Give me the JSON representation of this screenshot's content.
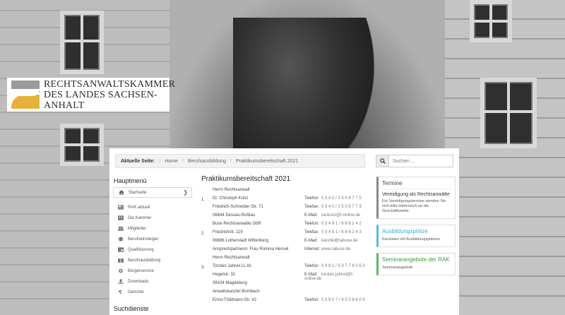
{
  "logo": {
    "line1": "RECHTSANWALTSKAMMER",
    "line2": "DES LANDES SACHSEN-ANHALT"
  },
  "breadcrumb": {
    "label": "Aktuelle Seite:",
    "items": [
      "Home",
      "Berufsausbildung",
      "Praktikumsbereitschaft 2021"
    ]
  },
  "search": {
    "placeholder": "Suchen ..."
  },
  "menu": {
    "title": "Hauptmenü",
    "items": [
      {
        "label": "Startseite",
        "icon": "home-icon"
      },
      {
        "label": "RAK aktuell",
        "icon": "news-icon"
      },
      {
        "label": "Die Kammer",
        "icon": "building-icon"
      },
      {
        "label": "Mitglieder",
        "icon": "users-icon"
      },
      {
        "label": "Berufseinsteiger",
        "icon": "graduation-icon"
      },
      {
        "label": "Qualifizierung",
        "icon": "certificate-icon"
      },
      {
        "label": "Berufsausbildung",
        "icon": "education-icon"
      },
      {
        "label": "Bürgerservice",
        "icon": "service-icon"
      },
      {
        "label": "Downloads",
        "icon": "download-icon"
      },
      {
        "label": "Gerichte",
        "icon": "gavel-icon"
      }
    ],
    "search_title": "Suchdienste"
  },
  "content": {
    "title": "Praktikumsbereitschaft 2021",
    "entries": [
      {
        "num": "1.",
        "left": [
          "Herrn Rechtsanwalt",
          "Dr. Christoph Kunz",
          "Friedrich-Schneider-Str. 71",
          "06844 Dessau-Roßlau"
        ],
        "right": [
          {
            "k": "",
            "v": ""
          },
          {
            "k": "Telefon:",
            "v": "0 3 4 0  /  2 5 0 8 7 7 5"
          },
          {
            "k": "Telefax:",
            "v": "0 3 4 0  /  2 5 0 8 7 7 3"
          },
          {
            "k": "E-Mail:",
            "v": "rackunz@t-online.de"
          }
        ]
      },
      {
        "num": "2.",
        "left": [
          "Buse Rechtsanwälte GbR",
          "Friedrichstr. 119",
          "06886 Lutherstadt Wittenberg",
          "Ansprechpartnerin: Frau Romina Hensel"
        ],
        "right": [
          {
            "k": "Telefon:",
            "v": "0 3 4 9 1  /  6 6 8 2 4 2"
          },
          {
            "k": "Telefax:",
            "v": "0 3 4 9 1  /  6 6 8 2 4 3"
          },
          {
            "k": "E-Mail:",
            "v": "kanzlei@rabuse.de"
          },
          {
            "k": "Internet:",
            "v": "www.rabuse.de"
          }
        ]
      },
      {
        "num": "3.",
        "left": [
          "Herrn Rechtsanwalt",
          "Torsten Jahnel LL.M.",
          "Hegelstr. 32",
          "39104 Magdeburg"
        ],
        "right": [
          {
            "k": "",
            "v": ""
          },
          {
            "k": "Telefon:",
            "v": "0 3 9 1  /  5 9 7 7 8 0 6 0"
          },
          {
            "k": "E-Mail:",
            "v": "torsten.jahnel@t-online.de"
          },
          {
            "k": "",
            "v": ""
          }
        ]
      },
      {
        "num": "",
        "left": [
          "Anwaltskanzlei Bombach",
          "Ernst-Thälmann-Str. 42"
        ],
        "right": [
          {
            "k": "",
            "v": ""
          },
          {
            "k": "Telefon:",
            "v": "0 3 9 0 7  /  6 5 0 8 6 0 9"
          }
        ]
      }
    ]
  },
  "widgets": {
    "termine": {
      "title": "Termine",
      "subtitle": "Vereidigung als Rechtsanwälte",
      "body": "Für Vereidigungstermine wenden Sie sich bitte telefonisch an die Geschäftsstelle."
    },
    "ausbildung": {
      "title": "Ausbildungsplätze",
      "body": "Kanzleien mit Ausbildungsplätzen"
    },
    "seminar": {
      "title": "Seminarangebote der RAK",
      "body": "Seminarangebote"
    }
  },
  "colors": {
    "accent_gold": "#e7b23b",
    "info_blue": "#4dbfe0",
    "success_green": "#5cb85c"
  }
}
